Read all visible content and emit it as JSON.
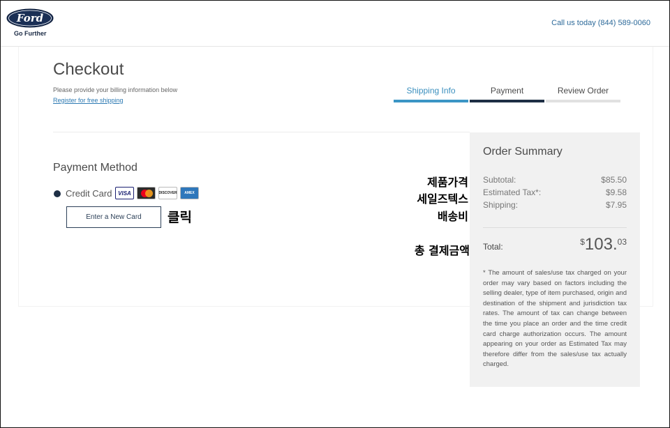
{
  "header": {
    "brand": "Ford",
    "tagline": "Go Further",
    "phone": "Call us today (844) 589-0060"
  },
  "page": {
    "title": "Checkout",
    "subtitle": "Please provide your billing information below",
    "register_link": "Register for free shipping"
  },
  "steps": [
    {
      "label": "Shipping Info",
      "state": "complete"
    },
    {
      "label": "Payment",
      "state": "active"
    },
    {
      "label": "Review Order",
      "state": "pending"
    }
  ],
  "payment": {
    "title": "Payment Method",
    "option_label": "Credit Card",
    "card_icons": {
      "visa": "VISA",
      "mastercard": "MasterCard",
      "discover": "DISCOVER",
      "amex": "AMEX"
    },
    "new_card_button": "Enter a New Card"
  },
  "annotations": {
    "click": "클릭",
    "product_price": "제품가격",
    "sales_tax": "세일즈텍스",
    "shipping_fee": "배송비",
    "total_payment": "총 결제금액"
  },
  "summary": {
    "title": "Order Summary",
    "rows": [
      {
        "label": "Subtotal:",
        "value": "$85.50"
      },
      {
        "label": "Estimated Tax*:",
        "value": "$9.58"
      },
      {
        "label": "Shipping:",
        "value": "$7.95"
      }
    ],
    "total_label": "Total:",
    "total_currency": "$",
    "total_int": "103.",
    "total_dec": "03",
    "disclaimer": "* The amount of sales/use tax charged on your order may vary based on factors including the selling dealer, type of item purchased, origin and destination of the shipment and jurisdiction tax rates. The amount of tax can change between the time you place an order and the time credit card charge authorization occurs. The amount appearing on your order as Estimated Tax may therefore differ from the sales/use tax actually charged."
  },
  "colors": {
    "brand_navy": "#1e2f45",
    "accent_blue": "#3b95c5",
    "link_blue": "#2d7ab3"
  }
}
